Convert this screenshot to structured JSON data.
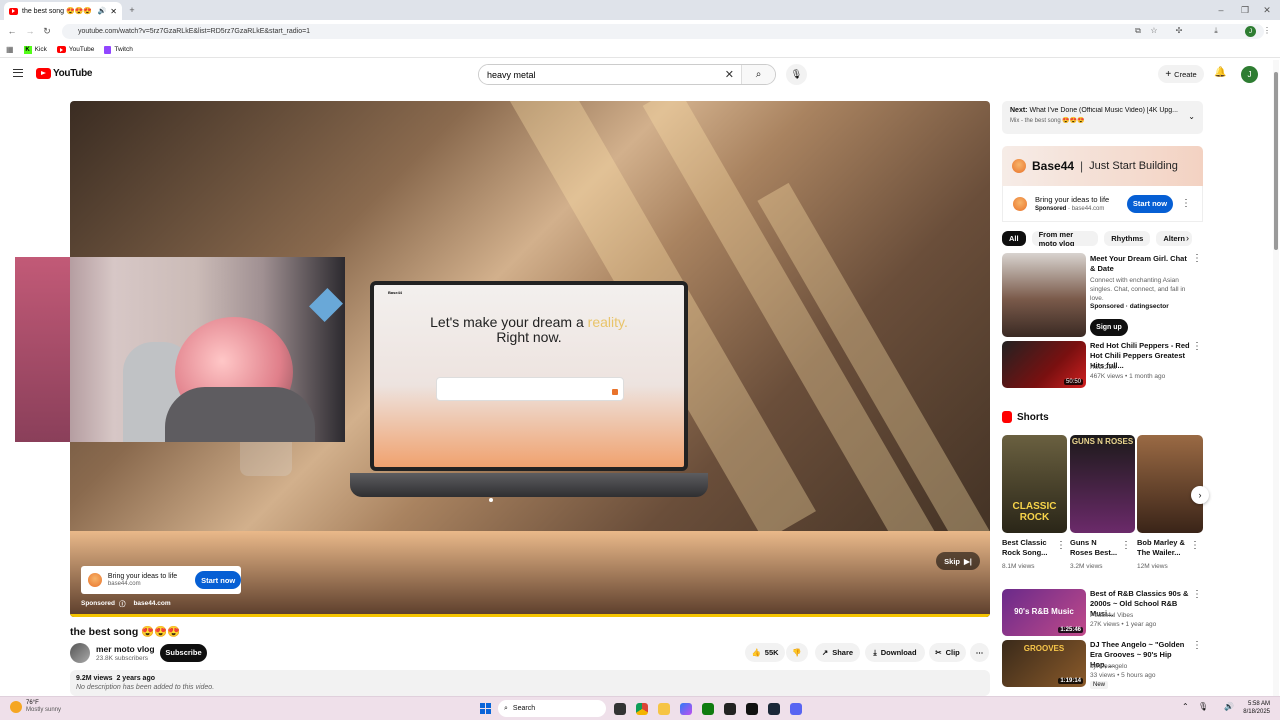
{
  "browser": {
    "tab_title": "the best song 😍😍😍 - Yo",
    "new_tab_icon": "plus-icon",
    "url": "youtube.com/watch?v=5rz7GzaRLkE&list=RD5rz7GzaRLkE&start_radio=1",
    "bookmarks": [
      "Kick",
      "YouTube",
      "Twitch"
    ],
    "profile_initial": "J"
  },
  "header": {
    "logo_text": "YouTube",
    "search_value": "heavy metal",
    "create_label": "Create",
    "avatar_initial": "J"
  },
  "video": {
    "laptop_headline_1": "Let's make your dream a",
    "laptop_headline_accent": "reality.",
    "laptop_headline_2": "Right now.",
    "laptop_brand": "Base44",
    "ad_card_title": "Bring your ideas to life",
    "ad_card_url": "base44.com",
    "ad_card_button": "Start now",
    "sponsored_label": "Sponsored",
    "sponsored_domain": "base44.com",
    "skip_label": "Skip"
  },
  "info": {
    "title": "the best song 😍😍😍",
    "channel": "mer moto vlog",
    "subscribers": "23.8K subscribers",
    "subscribe_label": "Subscribe",
    "likes": "55K",
    "share_label": "Share",
    "download_label": "Download",
    "clip_label": "Clip",
    "views_date": "9.2M views  2 years ago",
    "description": "No description has been added to this video."
  },
  "sidebar": {
    "next_label": "Next:",
    "next_title": "What I've Done (Official Music Video) [4K Upg...",
    "next_sub": "Mix - the best song 😍😍😍",
    "banner_brand": "Base44",
    "banner_tagline": "Just Start Building",
    "ad_title": "Bring your ideas to life",
    "ad_sponsored": "Sponsored",
    "ad_domain": "base44.com",
    "ad_button": "Start now",
    "chips": [
      "All",
      "From mer moto vlog",
      "Rhythms",
      "Altern"
    ],
    "items": [
      {
        "title": "Meet Your Dream Girl. Chat & Date",
        "desc": "Connect with enchanting Asian singles. Chat, connect, and fall in love.",
        "meta1": "Sponsored · datingsector",
        "button": "Sign up"
      },
      {
        "title": "Red Hot Chili Peppers - Red Hot Chili Peppers Greatest Hits full...",
        "meta1": "Rock2Bu",
        "meta2": "467K views • 1 month ago",
        "duration": "50:50"
      }
    ],
    "shorts_label": "Shorts",
    "shorts": [
      {
        "title": "Best Classic Rock Song...",
        "views": "8.1M views",
        "thumb_text": "CLASSIC ROCK"
      },
      {
        "title": "Guns N Roses Best...",
        "views": "3.2M views",
        "thumb_text": "GUNS N ROSES"
      },
      {
        "title": "Bob Marley & The Wailer...",
        "views": "12M views",
        "thumb_text": ""
      }
    ],
    "more": [
      {
        "title": "Best of R&B Classics 90s & 2000s ~ Old School R&B Musi...",
        "meta1": "Peaceful Vibes",
        "meta2": "27K views • 1 year ago",
        "duration": "1:25:46",
        "thumb_text": "90's R&B Music"
      },
      {
        "title": "DJ Thee Angelo ~ \"Golden Era Grooves ~ 90's Hip Hop, ...",
        "meta1": "djtheeangelo",
        "meta2": "33 views • 5 hours ago",
        "badge": "New",
        "duration": "1:19:14",
        "thumb_text": "GROOVES"
      }
    ]
  },
  "taskbar": {
    "temp": "76°F",
    "weather": "Mostly sunny",
    "search_label": "Search",
    "time": "5:58 AM",
    "date": "8/18/2025"
  }
}
